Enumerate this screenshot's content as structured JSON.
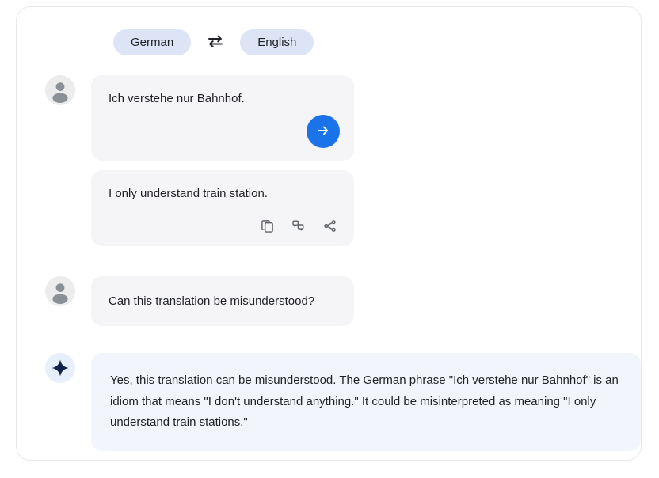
{
  "language_bar": {
    "source_language": "German",
    "target_language": "English",
    "swap_icon": "swap-horizontal-icon"
  },
  "messages": {
    "source": {
      "text": "Ich verstehe nur Bahnhof.",
      "avatar_icon": "user-avatar-icon",
      "send_icon": "arrow-right-icon"
    },
    "result": {
      "text": "I only understand train station.",
      "actions": [
        {
          "icon": "copy-icon",
          "label": "Copy"
        },
        {
          "icon": "quote-feedback-icon",
          "label": "Feedback"
        },
        {
          "icon": "share-icon",
          "label": "Share"
        }
      ]
    },
    "question": {
      "text": "Can this translation be misunderstood?",
      "avatar_icon": "user-avatar-icon"
    },
    "answer": {
      "text": "Yes, this translation can be misunderstood. The German phrase \"Ich verstehe nur Bahnhof\" is an idiom that means \"I don't understand anything.\" It could be misinterpreted as meaning \"I only understand train stations.\"",
      "avatar_icon": "sparkle-icon"
    }
  },
  "colors": {
    "accent_blue": "#1a73e8",
    "chip_background": "#dde4f5",
    "user_bubble": "#f5f5f7",
    "ai_bubble": "#f2f5fb",
    "sparkle": "#12224a",
    "text_primary": "#1f2126"
  }
}
